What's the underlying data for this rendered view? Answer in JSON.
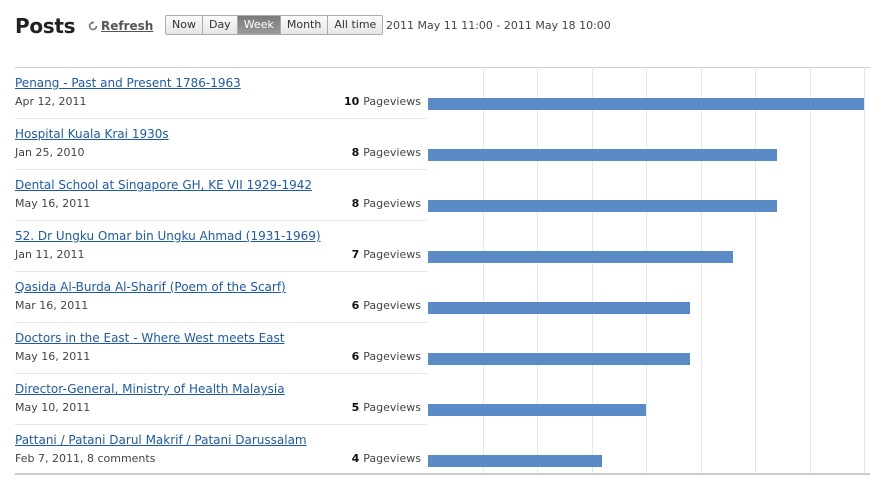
{
  "header": {
    "title": "Posts",
    "refresh_label": "Refresh",
    "range_buttons": [
      "Now",
      "Day",
      "Week",
      "Month",
      "All time"
    ],
    "active_range": "Week",
    "date_range": "2011 May 11 11:00 - 2011 May 18 10:00"
  },
  "chart_data": {
    "type": "bar",
    "max_value": 10,
    "bar_color": "#5a8bc6",
    "categories": [
      "Penang - Past and Present 1786-1963",
      "Hospital Kuala Krai 1930s",
      "Dental School at Singapore GH, KE VII 1929-1942",
      "52. Dr Ungku Omar bin Ungku Ahmad (1931-1969)",
      "Qasida Al-Burda Al-Sharif (Poem of the Scarf)",
      "Doctors in the East - Where West meets East",
      "Director-General, Ministry of Health Malaysia",
      "Pattani / Patani Darul Makrif / Patani Darussalam"
    ],
    "values": [
      10,
      8,
      8,
      7,
      6,
      6,
      5,
      4
    ]
  },
  "posts": [
    {
      "title": "Penang - Past and Present 1786-1963",
      "date": "Apr 12, 2011",
      "count": "10",
      "unit": "Pageviews"
    },
    {
      "title": "Hospital Kuala Krai 1930s",
      "date": "Jan 25, 2010",
      "count": "8",
      "unit": "Pageviews"
    },
    {
      "title": "Dental School at Singapore GH, KE VII 1929-1942",
      "date": "May 16, 2011",
      "count": "8",
      "unit": "Pageviews"
    },
    {
      "title": "52. Dr Ungku Omar bin Ungku Ahmad (1931-1969)",
      "date": "Jan 11, 2011",
      "count": "7",
      "unit": "Pageviews"
    },
    {
      "title": "Qasida Al-Burda Al-Sharif (Poem of the Scarf)",
      "date": "Mar 16, 2011",
      "count": "6",
      "unit": "Pageviews"
    },
    {
      "title": "Doctors in the East - Where West meets East",
      "date": "May 16, 2011",
      "count": "6",
      "unit": "Pageviews"
    },
    {
      "title": "Director-General, Ministry of Health Malaysia",
      "date": "May 10, 2011",
      "count": "5",
      "unit": "Pageviews"
    },
    {
      "title": "Pattani / Patani Darul Makrif / Patani Darussalam",
      "date": "Feb 7, 2011, 8 comments",
      "count": "4",
      "unit": "Pageviews"
    }
  ],
  "icons": {
    "refresh": "refresh-icon"
  }
}
